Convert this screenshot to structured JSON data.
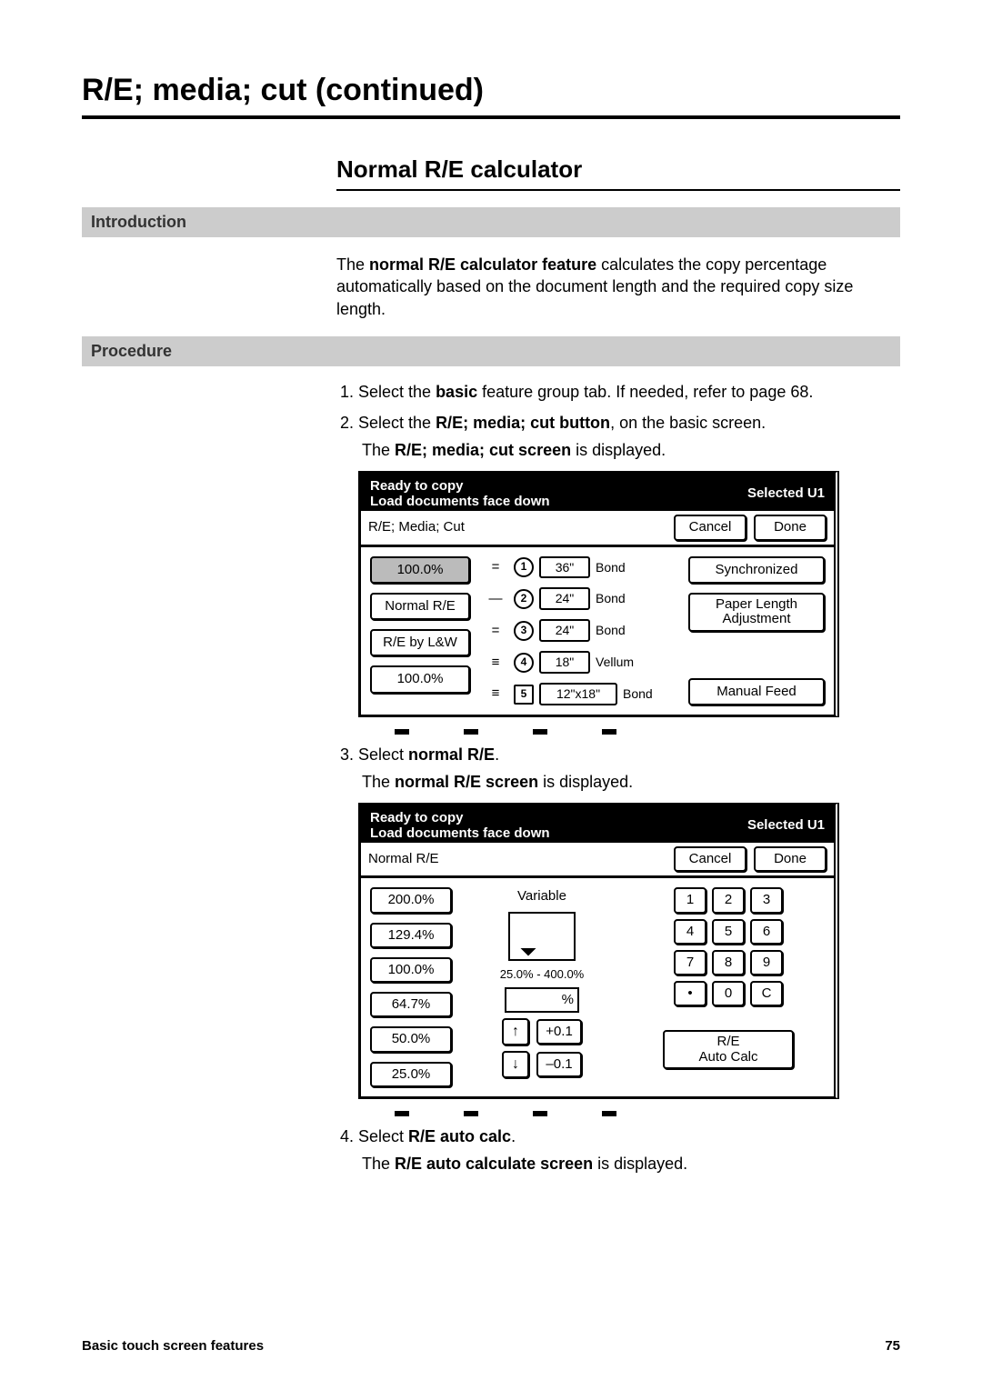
{
  "page": {
    "title": "R/E; media; cut (continued)",
    "subtitle": "Normal R/E calculator",
    "footer_left": "Basic touch screen features",
    "footer_right": "75"
  },
  "intro": {
    "heading": "Introduction",
    "text_pre": "The ",
    "text_bold": "normal R/E calculator feature",
    "text_post": " calculates the copy percentage automatically based on the document length and the required copy size length."
  },
  "proc": {
    "heading": "Procedure",
    "s1_a": "Select the ",
    "s1_b": "basic",
    "s1_c": " feature group tab.  If needed, refer to page 68.",
    "s2_a": "Select the ",
    "s2_b": "R/E; media; cut button",
    "s2_c": ", on the basic screen.",
    "s2_sub_a": "The ",
    "s2_sub_b": "R/E; media; cut screen",
    "s2_sub_c": " is displayed.",
    "s3_a": "Select ",
    "s3_b": "normal R/E",
    "s3_c": ".",
    "s3_sub_a": "The ",
    "s3_sub_b": "normal R/E screen",
    "s3_sub_c": " is displayed.",
    "s4_a": "Select ",
    "s4_b": "R/E auto calc",
    "s4_c": ".",
    "s4_sub_a": "The ",
    "s4_sub_b": "R/E auto calculate screen",
    "s4_sub_c": " is displayed."
  },
  "lcd1": {
    "top1": "Ready to copy",
    "top2": "Load documents face down",
    "topR": "Selected  U1",
    "title": "R/E; Media; Cut",
    "cancel": "Cancel",
    "done": "Done",
    "left": [
      "100.0%",
      "Normal R/E",
      "R/E by L&W",
      "100.0%"
    ],
    "media": [
      {
        "icon": "=",
        "num": "1",
        "size": "36\"",
        "type": "Bond"
      },
      {
        "icon": "—",
        "num": "2",
        "size": "24\"",
        "type": "Bond"
      },
      {
        "icon": "=",
        "num": "3",
        "size": "24\"",
        "type": "Bond"
      },
      {
        "icon": "≡",
        "num": "4",
        "size": "18\"",
        "type": "Vellum"
      },
      {
        "icon": "≡",
        "num": "5",
        "size": "12\"x18\"",
        "type": "Bond",
        "sheet": true
      }
    ],
    "right": [
      "Synchronized",
      "Paper Length Adjustment",
      "Manual Feed"
    ]
  },
  "lcd2": {
    "top1": "Ready to copy",
    "top2": "Load documents face down",
    "topR": "Selected  U1",
    "title": "Normal R/E",
    "cancel": "Cancel",
    "done": "Done",
    "left": [
      "200.0%",
      "129.4%",
      "100.0%",
      "64.7%",
      "50.0%",
      "25.0%"
    ],
    "variable": "Variable",
    "range": "25.0% - 400.0%",
    "pct": "%",
    "up": "+0.1",
    "down": "–0.1",
    "keys": [
      "1",
      "2",
      "3",
      "4",
      "5",
      "6",
      "7",
      "8",
      "9",
      "•",
      "0",
      "C"
    ],
    "autocalc1": "R/E",
    "autocalc2": "Auto Calc"
  }
}
